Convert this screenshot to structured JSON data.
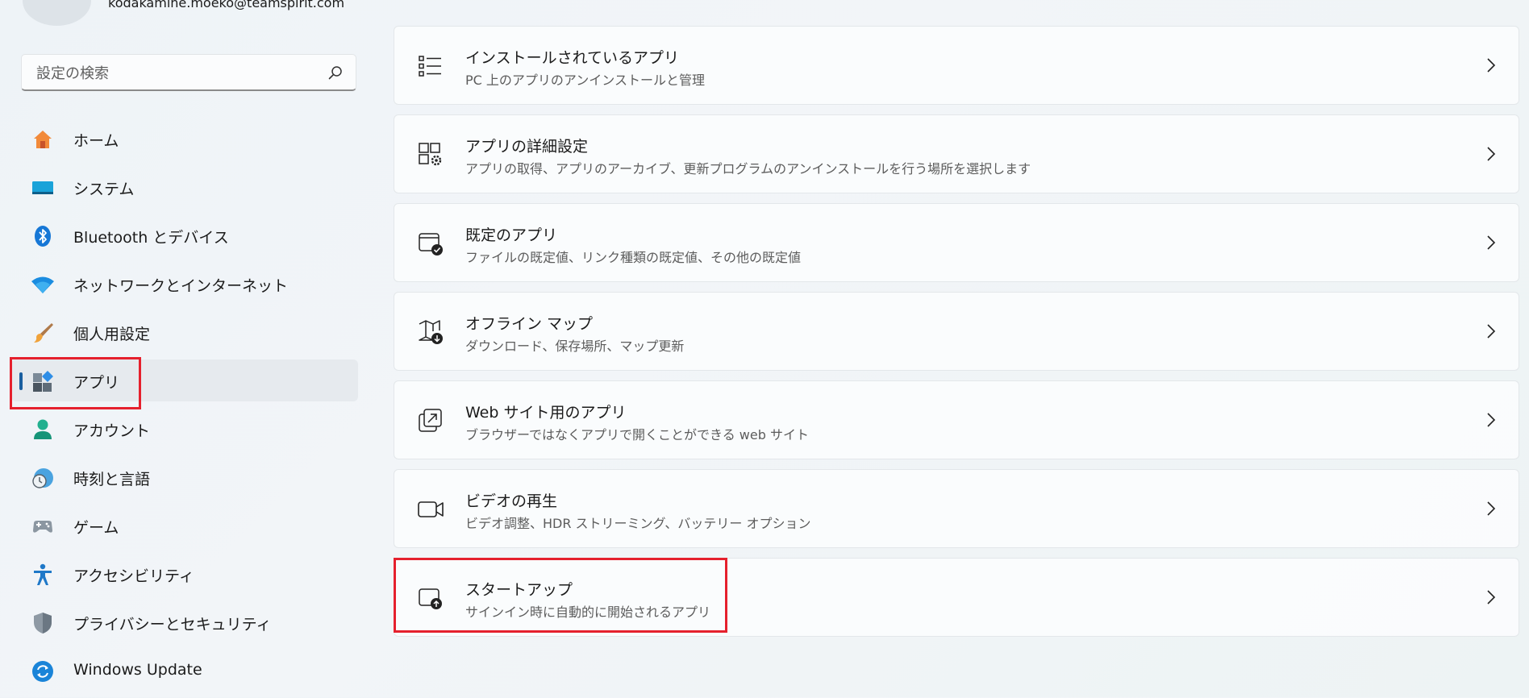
{
  "user": {
    "email": "kodakamine.moeko@teamspirit.com"
  },
  "search": {
    "placeholder": "設定の検索"
  },
  "sidebar": {
    "items": [
      {
        "label": "ホーム",
        "icon": "home-icon"
      },
      {
        "label": "システム",
        "icon": "system-icon"
      },
      {
        "label": "Bluetooth とデバイス",
        "icon": "bluetooth-icon"
      },
      {
        "label": "ネットワークとインターネット",
        "icon": "wifi-icon"
      },
      {
        "label": "個人用設定",
        "icon": "paintbrush-icon"
      },
      {
        "label": "アプリ",
        "icon": "apps-icon",
        "selected": true
      },
      {
        "label": "アカウント",
        "icon": "account-icon"
      },
      {
        "label": "時刻と言語",
        "icon": "time-language-icon"
      },
      {
        "label": "ゲーム",
        "icon": "gamepad-icon"
      },
      {
        "label": "アクセシビリティ",
        "icon": "accessibility-icon"
      },
      {
        "label": "プライバシーとセキュリティ",
        "icon": "shield-icon"
      },
      {
        "label": "Windows Update",
        "icon": "windows-update-icon"
      }
    ]
  },
  "main": {
    "cards": [
      {
        "title": "インストールされているアプリ",
        "subtitle": "PC 上のアプリのアンインストールと管理",
        "icon": "list-icon"
      },
      {
        "title": "アプリの詳細設定",
        "subtitle": "アプリの取得、アプリのアーカイブ、更新プログラムのアンインストールを行う場所を選択します",
        "icon": "app-settings-gear-icon"
      },
      {
        "title": "既定のアプリ",
        "subtitle": "ファイルの既定値、リンク種類の既定値、その他の既定値",
        "icon": "default-apps-check-icon"
      },
      {
        "title": "オフライン マップ",
        "subtitle": "ダウンロード、保存場所、マップ更新",
        "icon": "offline-map-icon"
      },
      {
        "title": "Web サイト用のアプリ",
        "subtitle": "ブラウザーではなくアプリで開くことができる web サイト",
        "icon": "open-external-icon"
      },
      {
        "title": "ビデオの再生",
        "subtitle": "ビデオ調整、HDR ストリーミング、バッテリー オプション",
        "icon": "video-camera-icon"
      },
      {
        "title": "スタートアップ",
        "subtitle": "サインイン時に自動的に開始されるアプリ",
        "icon": "startup-icon"
      }
    ]
  },
  "colors": {
    "accent": "#1a5fa0",
    "highlight": "#e5202d"
  }
}
